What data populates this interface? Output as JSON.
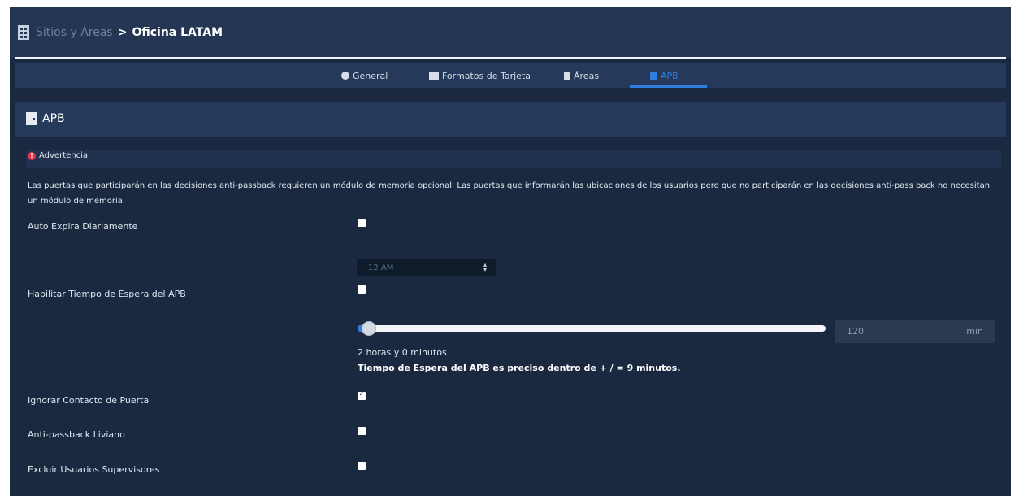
{
  "header": {
    "breadcrumb_parent": "Sitios y Áreas",
    "breadcrumb_separator": ">",
    "breadcrumb_current": "Oficina LATAM"
  },
  "tabs": [
    {
      "label": "General",
      "icon": "gear-icon"
    },
    {
      "label": "Formatos de Tarjeta",
      "icon": "id-card-icon"
    },
    {
      "label": "Áreas",
      "icon": "building-icon"
    },
    {
      "label": "APB",
      "icon": "door-icon",
      "active": true
    }
  ],
  "section": {
    "title": "APB",
    "icon": "door-icon"
  },
  "warning": {
    "title": "Advertencia",
    "icon": "!",
    "text": "Las puertas que participarán en las decisiones anti-passback requieren un módulo de memoria opcional. Las puertas que informarán las ubicaciones de los usuarios pero que no participarán en las decisiones anti-pass back no necesitan un módulo de memoria."
  },
  "settings": {
    "auto_expire": {
      "label": "Auto Expira Diariamente",
      "checked": false
    },
    "expire_time": {
      "value": "12 AM",
      "arrows": "▴\n▾"
    },
    "apb_timeout": {
      "label": "Habilitar Tiempo de Espera del APB",
      "checked": false
    },
    "timeout_slider": {
      "value": 120,
      "min": 0,
      "max": 7200,
      "fill_fraction": 0.025
    },
    "timeout_value": "120",
    "timeout_unit": "min",
    "timeout_duration_text": "2 horas y 0 minutos",
    "timeout_accuracy_text": "Tiempo de Espera del APB es preciso dentro de + / = 9 minutos.",
    "ignore_door_contact": {
      "label": "Ignorar Contacto de Puerta",
      "checked": true
    },
    "soft_apb": {
      "label": "Anti-passback Liviano",
      "checked": false
    },
    "exclude_supervisors": {
      "label": "Excluir Usuarios Supervisores",
      "checked": false
    }
  },
  "colors": {
    "background": "#1b2940",
    "header": "#243653",
    "accent": "#2f7dde",
    "warning": "#e0344a"
  }
}
